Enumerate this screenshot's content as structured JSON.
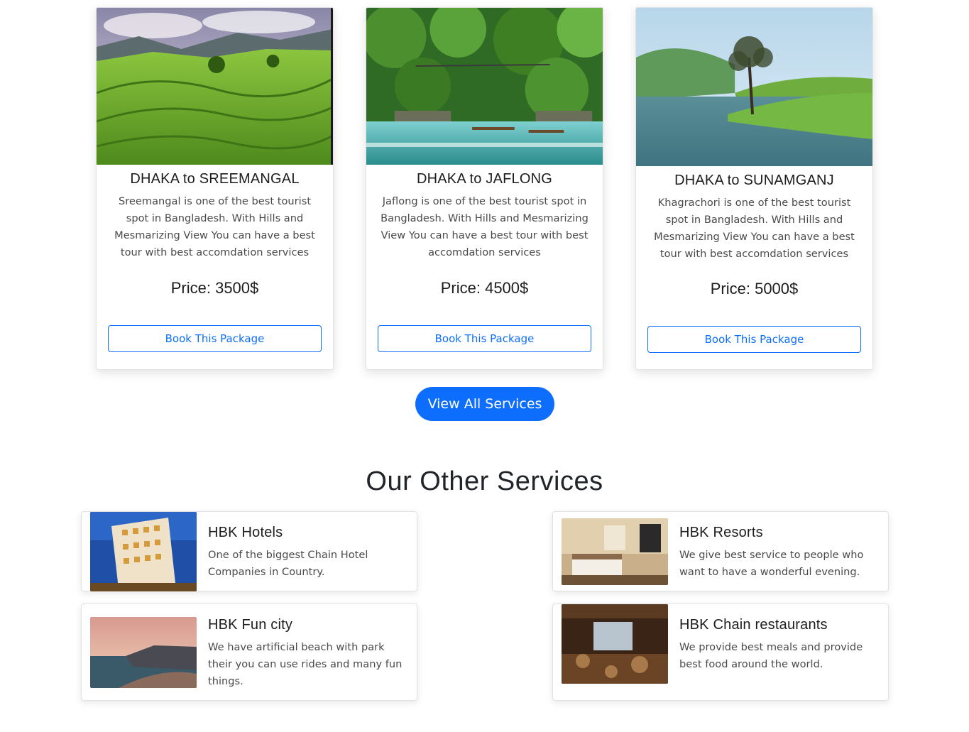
{
  "packages": [
    {
      "title": "DHAKA to SREEMANGAL",
      "description": "Sreemangal is one of the best tourist spot in Bangladesh. With Hills and Mesmarizing View You can have a best tour with best accomdation services",
      "price": "Price: 3500$",
      "button": "Book This Package"
    },
    {
      "title": "DHAKA to JAFLONG",
      "description": "Jaflong is one of the best tourist spot in Bangladesh. With Hills and Mesmarizing View You can have a best tour with best accomdation services",
      "price": "Price: 4500$",
      "button": "Book This Package"
    },
    {
      "title": "DHAKA to SUNAMGANJ",
      "description": "Khagrachori is one of the best tourist spot in Bangladesh. With Hills and Mesmarizing View You can have a best tour with best accomdation services",
      "price": "Price: 5000$",
      "button": "Book This Package"
    }
  ],
  "view_all_label": "View All Services",
  "other_services": {
    "title": "Our Other Services",
    "items": [
      {
        "title": "HBK Hotels",
        "description": "One of the biggest Chain Hotel Companies in Country."
      },
      {
        "title": "HBK Resorts",
        "description": "We give best service to people who want to have a wonderful evening."
      },
      {
        "title": "HBK Fun city",
        "description": "We have artificial beach with park their you can use rides and many fun things."
      },
      {
        "title": "HBK Chain restaurants",
        "description": "We provide best meals and provide best food around the world."
      }
    ]
  },
  "colors": {
    "primary": "#0d6efd",
    "text": "#212529",
    "muted": "#4a4a4a"
  }
}
